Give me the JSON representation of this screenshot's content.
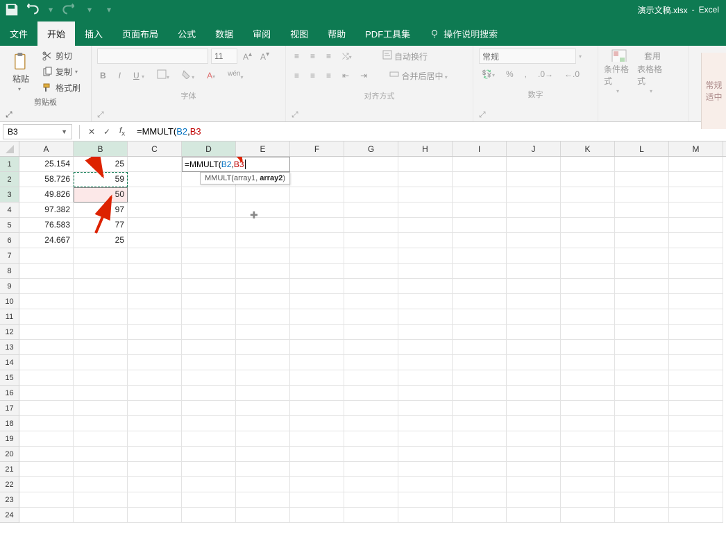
{
  "window": {
    "doc_title": "演示文稿.xlsx",
    "app_name": "Excel"
  },
  "menu": {
    "file": "文件",
    "home": "开始",
    "insert": "插入",
    "layout": "页面布局",
    "formulas": "公式",
    "data": "数据",
    "review": "审阅",
    "view": "视图",
    "help": "帮助",
    "pdf": "PDF工具集",
    "tell_me": "操作说明搜索"
  },
  "ribbon": {
    "clipboard": {
      "paste": "粘贴",
      "cut": "剪切",
      "copy": "复制",
      "format_painter": "格式刷",
      "label": "剪贴板"
    },
    "font": {
      "name_placeholder": "",
      "size": "11",
      "label": "字体"
    },
    "alignment": {
      "wrap": "自动换行",
      "merge": "合并后居中",
      "label": "对齐方式"
    },
    "number": {
      "general": "常规",
      "label": "数字"
    },
    "styles": {
      "cond": "条件格式",
      "table": "套用",
      "table2": "表格格式",
      "label": ""
    },
    "right_clip": {
      "l1": "常规",
      "l2": "适中"
    }
  },
  "formula_bar": {
    "name_box": "B3",
    "formula_text": "=MMULT(B2,B3",
    "formula_prefix": "=MMULT(",
    "arg1": "B2",
    "comma": ",",
    "arg2": "B3"
  },
  "editing": {
    "prefix": "=MMULT",
    "open": "(",
    "arg1": "B2",
    "comma": ", ",
    "arg2": "B3"
  },
  "tooltip": {
    "fn": "MMULT",
    "open": "(",
    "a1_label": "array1",
    "sep": ", ",
    "a2_label": "array2",
    "close": ")"
  },
  "columns": [
    "A",
    "B",
    "C",
    "D",
    "E",
    "F",
    "G",
    "H",
    "I",
    "J",
    "K",
    "L",
    "M"
  ],
  "rows": [
    "1",
    "2",
    "3",
    "4",
    "5",
    "6",
    "7",
    "8",
    "9",
    "10",
    "11",
    "12",
    "13",
    "14",
    "15",
    "16",
    "17",
    "18",
    "19",
    "20",
    "21",
    "22",
    "23",
    "24"
  ],
  "data": {
    "A": [
      "25.154",
      "58.726",
      "49.826",
      "97.382",
      "76.583",
      "24.667"
    ],
    "B": [
      "25",
      "59",
      "50",
      "97",
      "77",
      "25"
    ]
  }
}
